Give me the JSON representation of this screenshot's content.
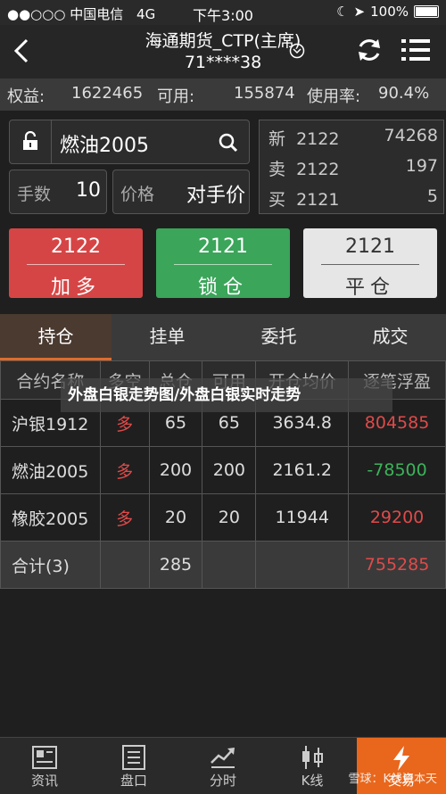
{
  "status": {
    "carrier": "中国电信",
    "network": "4G",
    "time": "下午3:00",
    "battery": "100%"
  },
  "header": {
    "title_line1": "海通期货_CTP(主席)",
    "title_line2": "71****38"
  },
  "account": {
    "equity_label": "权益:",
    "equity": "1622465",
    "avail_label": "可用:",
    "avail": "155874",
    "usage_label": "使用率:",
    "usage": "90.4%"
  },
  "order": {
    "contract": "燃油2005",
    "qty_label": "手数",
    "qty": "10",
    "price_label": "价格",
    "price": "对手价"
  },
  "quote": [
    {
      "label": "新",
      "price": "2122",
      "vol": "74268"
    },
    {
      "label": "卖",
      "price": "2122",
      "vol": "197"
    },
    {
      "label": "买",
      "price": "2121",
      "vol": "5"
    }
  ],
  "buttons": {
    "buy": {
      "price": "2122",
      "text": "加多"
    },
    "sell": {
      "price": "2121",
      "text": "锁仓"
    },
    "close": {
      "price": "2121",
      "text": "平仓"
    }
  },
  "tabs": [
    "持仓",
    "挂单",
    "委托",
    "成交"
  ],
  "table": {
    "headers": [
      "合约名称",
      "多空",
      "总仓",
      "可用",
      "开仓均价",
      "逐笔浮盈"
    ],
    "rows": [
      [
        "沪银1912",
        "多",
        "65",
        "65",
        "3634.8",
        "804585"
      ],
      [
        "燃油2005",
        "多",
        "200",
        "200",
        "2161.2",
        "-78500"
      ],
      [
        "橡胶2005",
        "多",
        "20",
        "20",
        "11944",
        "29200"
      ]
    ],
    "total": {
      "label": "合计(3)",
      "qty": "285",
      "pnl": "755285"
    }
  },
  "overlay_text": "外盘白银走势图/外盘白银实时走势",
  "bottom": [
    "资讯",
    "盘口",
    "分时",
    "K线",
    "交易"
  ],
  "watermark": "雪球：K线资本天"
}
